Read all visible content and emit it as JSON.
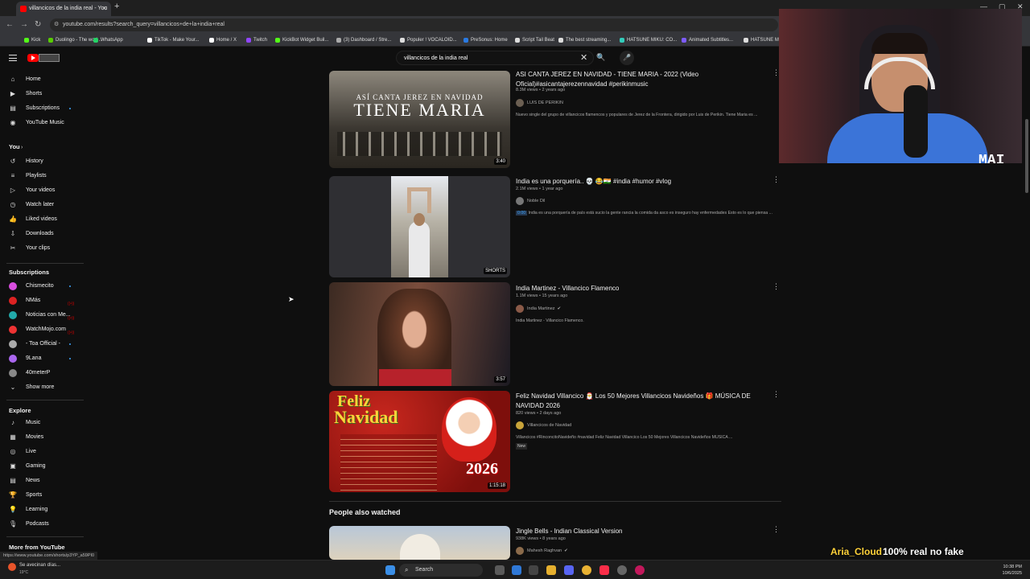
{
  "browser": {
    "tab_title": "villancicos de la india real - You",
    "url": "youtube.com/results?search_query=villancicos+de+la+india+real",
    "bookmarks": [
      {
        "label": "Kick",
        "color": "#53fc18"
      },
      {
        "label": "Duolingo - The worl...",
        "color": "#58cc02"
      },
      {
        "label": "WhatsApp",
        "color": "#25d366"
      },
      {
        "label": "TikTok - Make Your...",
        "color": "#ffffff"
      },
      {
        "label": "Home / X",
        "color": "#ffffff"
      },
      {
        "label": "Twitch",
        "color": "#9146ff"
      },
      {
        "label": "KickBot Widget Buil...",
        "color": "#53fc18"
      },
      {
        "label": "(3) Dashboard / Stre...",
        "color": "#aaaaaa"
      },
      {
        "label": "Populer ! VOCALOID...",
        "color": "#dddddd"
      },
      {
        "label": "PreSonus: Home",
        "color": "#2a7ae2"
      },
      {
        "label": "Script Tail Beat",
        "color": "#dddddd"
      },
      {
        "label": "The best streaming...",
        "color": "#dddddd"
      },
      {
        "label": "HATSUNE MIKU: CO...",
        "color": "#33ccbb"
      },
      {
        "label": "Animated Subtitles...",
        "color": "#7d5cff"
      },
      {
        "label": "HATSUNE MI",
        "color": "#dddddd"
      }
    ]
  },
  "header": {
    "search_query": "villancicos de la india real"
  },
  "sidebar": {
    "main": [
      "Home",
      "Shorts",
      "Subscriptions",
      "YouTube Music"
    ],
    "you_label": "You",
    "you": [
      "History",
      "Playlists",
      "Your videos",
      "Watch later",
      "Liked videos",
      "Downloads",
      "Your clips"
    ],
    "subscriptions_label": "Subscriptions",
    "subscriptions": [
      {
        "name": "Chismecito",
        "color": "#d94ee0"
      },
      {
        "name": "NMás",
        "color": "#d22"
      },
      {
        "name": "Noticias con Me...",
        "color": "#2aa"
      },
      {
        "name": "WatchMojo.com",
        "color": "#e33"
      },
      {
        "name": "- Toa Official -",
        "color": "#aaa"
      },
      {
        "name": "9Lana",
        "color": "#a6e"
      },
      {
        "name": "40meterP",
        "color": "#888"
      }
    ],
    "show_more": "Show more",
    "explore_label": "Explore",
    "explore": [
      "Music",
      "Movies",
      "Live",
      "Gaming",
      "News",
      "Sports",
      "Learning",
      "Podcasts"
    ],
    "more_label": "More from YouTube",
    "status_url": "https://www.youtube.com/shorts/p3YP_a59PI0"
  },
  "results": [
    {
      "title": "ASI CANTA JEREZ EN NAVIDAD - TIENE MARIA - 2022 (Video Oficial)#asicantajerezennavidad #perikinmusic",
      "meta": "8.3M views • 2 years ago",
      "channel": "LUIS DE PERIKIN",
      "desc": "Nuevo single del grupo de villancicos flamencos y populares de Jerez de la Frontera, dirigido por Luis de Perikin. Tiene Maria es ...",
      "duration": "3:40",
      "thumb_text": "ASÍ CANTA JEREZ EN NAVIDAD",
      "thumb_big": "TIENE MARIA"
    },
    {
      "title": "India es una porquería.. 💀 😂🇮🇳 #india #humor #vlog",
      "meta": "2.1M views • 1 year ago",
      "channel": "Noble Dil",
      "desc_badge": "0:00",
      "desc": "India es una porquería de país está sucio la gente rancia la comida da asco es inseguro hay enfermedades Esto es lo que piensa ...",
      "duration": "SHORTS"
    },
    {
      "title": "India Martinez - Villancico Flamenco",
      "meta": "1.1M views • 15 years ago",
      "channel": "India Martinez",
      "desc": "India Martinez - Villancico Flamenco.",
      "duration": "3:57"
    },
    {
      "title": "Feliz Navidad Villancico 🎅 Los 50 Mejores Villancicos Navideños 🎁 MÚSICA DE NAVIDAD 2026",
      "meta": "820 views • 2 days ago",
      "channel": "Villancicos de Navidad",
      "desc": "Villancicos #RinconcitoNavideño #navidad Feliz Navidad Villancico Los 50 Mejores Villancicos Navideños MÚSICA ...",
      "new_badge": "New",
      "duration": "1:15:18",
      "thumb_title1": "Feliz",
      "thumb_title2": "Navidad",
      "thumb_year": "2026"
    }
  ],
  "people_also_watched": {
    "heading": "People also watched",
    "title": "Jingle Bells - Indian Classical Version",
    "meta": "938K views • 8 years ago",
    "channel": "Mahesh Raghvan"
  },
  "stream_overlay": {
    "username": "Aria_Cloud",
    "message": "100% real no fake",
    "cam_tag": "MAI"
  },
  "taskbar": {
    "weather_text": "Se avecinan días...",
    "temp": "19°C",
    "search_label": "Search",
    "time": "10:38 PM",
    "date": "10/6/2025"
  }
}
